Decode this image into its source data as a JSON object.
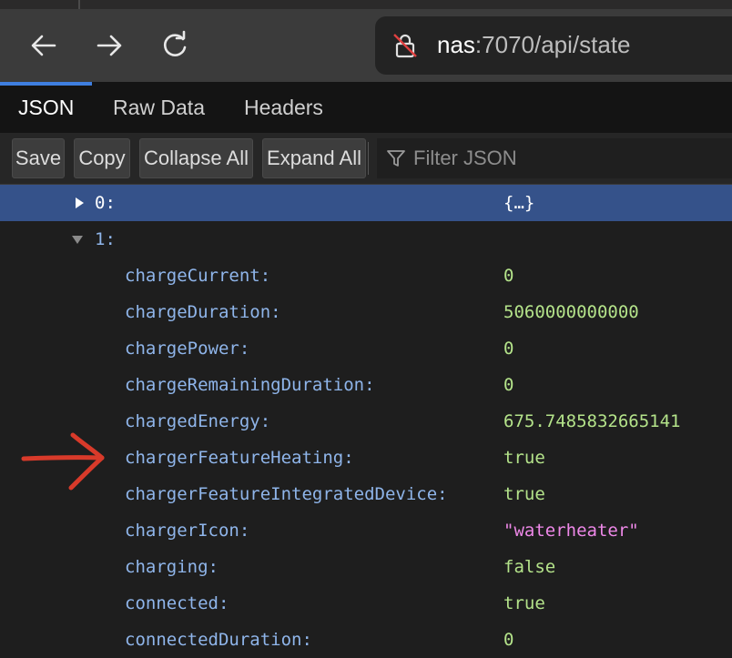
{
  "browser": {
    "url_host": "nas",
    "url_rest": ":7070/api/state"
  },
  "tabs": [
    {
      "label": "JSON",
      "active": true
    },
    {
      "label": "Raw Data",
      "active": false
    },
    {
      "label": "Headers",
      "active": false
    }
  ],
  "toolbar": {
    "save": "Save",
    "copy": "Copy",
    "collapse_all": "Collapse All",
    "expand_all": "Expand All",
    "filter_placeholder": "Filter JSON"
  },
  "tree": {
    "row0": {
      "key": "0:",
      "value": "{…}",
      "expanded": false
    },
    "row1": {
      "key": "1:",
      "expanded": true
    },
    "fields": [
      {
        "key": "chargeCurrent:",
        "value": "0",
        "type": "num"
      },
      {
        "key": "chargeDuration:",
        "value": "5060000000000",
        "type": "num"
      },
      {
        "key": "chargePower:",
        "value": "0",
        "type": "num"
      },
      {
        "key": "chargeRemainingDuration:",
        "value": "0",
        "type": "num"
      },
      {
        "key": "chargedEnergy:",
        "value": "675.7485832665141",
        "type": "num"
      },
      {
        "key": "chargerFeatureHeating:",
        "value": "true",
        "type": "bool"
      },
      {
        "key": "chargerFeatureIntegratedDevice:",
        "value": "true",
        "type": "bool"
      },
      {
        "key": "chargerIcon:",
        "value": "\"waterheater\"",
        "type": "str"
      },
      {
        "key": "charging:",
        "value": "false",
        "type": "bool"
      },
      {
        "key": "connected:",
        "value": "true",
        "type": "bool"
      },
      {
        "key": "connectedDuration:",
        "value": "0",
        "type": "num"
      }
    ]
  },
  "colors": {
    "accent": "#3f7fe0",
    "selected_row": "#35528a",
    "key": "#8fb5ea",
    "number": "#b4e38a",
    "string": "#ee88e8",
    "annotation_arrow": "#d83a2a"
  }
}
